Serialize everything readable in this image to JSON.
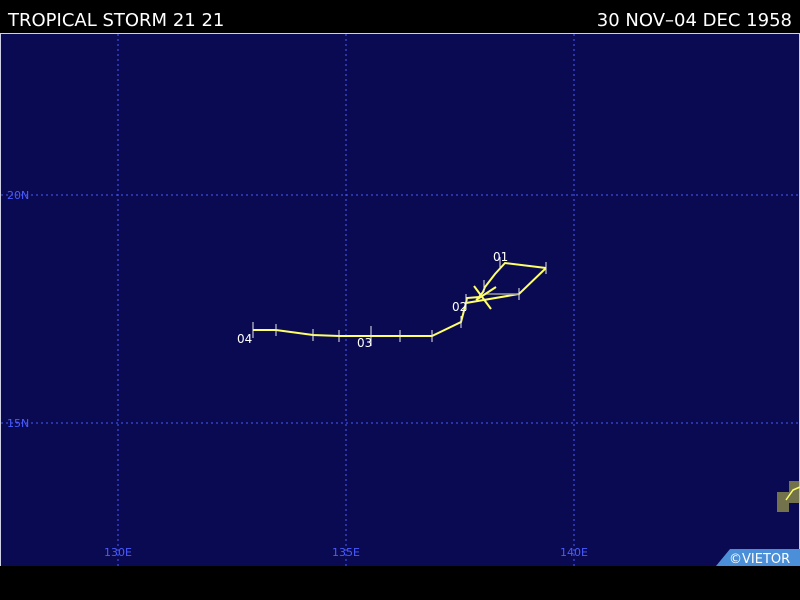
{
  "header": {
    "title": "TROPICAL STORM 21 21",
    "date_range": "30 NOV–04 DEC 1958"
  },
  "credit": "©VIETOR",
  "map": {
    "background": "#0a0a52",
    "grid_color": "#4a5bff",
    "track_color": "#ffff66",
    "lon_labels": [
      "130E",
      "135E",
      "140E"
    ],
    "lat_labels": [
      "20N",
      "15N"
    ],
    "track": [
      [
        139.4,
        18.6
      ],
      [
        138.9,
        17.9
      ],
      [
        138.1,
        17.9
      ],
      [
        137.7,
        17.7
      ],
      [
        137.6,
        17.3
      ],
      [
        137.3,
        17.1
      ],
      [
        137.0,
        16.9
      ],
      [
        136.3,
        16.9
      ],
      [
        135.6,
        16.9
      ],
      [
        134.8,
        16.9
      ],
      [
        134.1,
        16.9
      ],
      [
        133.4,
        17.0
      ],
      [
        132.9,
        17.1
      ]
    ],
    "loop": [
      [
        139.4,
        18.6
      ],
      [
        138.7,
        18.7
      ],
      [
        138.3,
        18.4
      ],
      [
        138.1,
        18.0
      ],
      [
        137.9,
        17.9
      ],
      [
        137.6,
        17.9
      ],
      [
        137.5,
        17.7
      ]
    ],
    "day_labels": [
      "01",
      "02",
      "03",
      "04"
    ],
    "next_storm_fragment_color": "#c8c848"
  }
}
